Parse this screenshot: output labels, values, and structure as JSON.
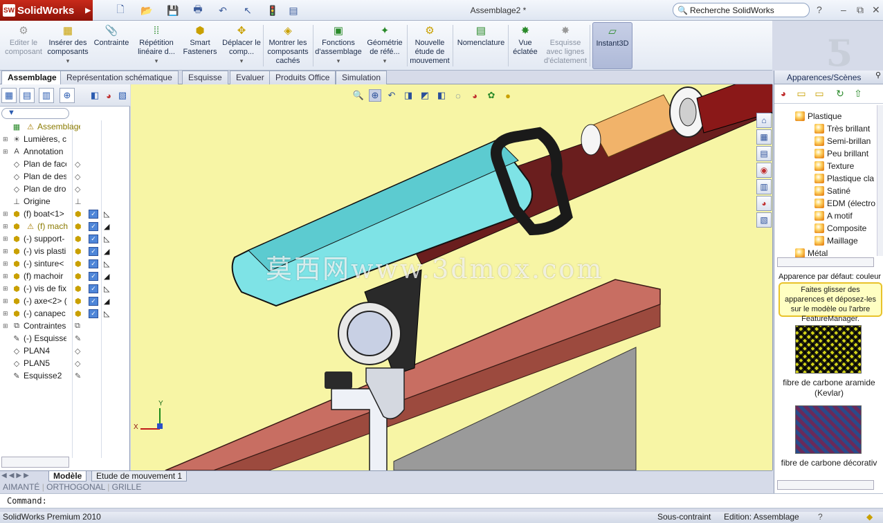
{
  "app": {
    "name": "SolidWorks",
    "doc_title": "Assemblage2 *"
  },
  "search": {
    "placeholder": "Recherche SolidWorks"
  },
  "ribbon": {
    "items": [
      {
        "label": "Editer le composant",
        "disabled": true
      },
      {
        "label": "Insérer des composants",
        "dropdown": true
      },
      {
        "label": "Contrainte"
      },
      {
        "label": "Répétition linéaire d...",
        "dropdown": true
      },
      {
        "label": "Smart Fasteners"
      },
      {
        "label": "Déplacer le comp...",
        "dropdown": true
      },
      {
        "label": "Montrer les composants cachés"
      },
      {
        "label": "Fonctions d'assemblage",
        "dropdown": true
      },
      {
        "label": "Géométrie de réfé...",
        "dropdown": true
      },
      {
        "label": "Nouvelle étude de mouvement"
      },
      {
        "label": "Nomenclature"
      },
      {
        "label": "Vue éclatée"
      },
      {
        "label": "Esquisse avec lignes d'éclatement",
        "disabled": true
      },
      {
        "label": "Instant3D",
        "active": true
      }
    ]
  },
  "command_tabs": [
    "Assemblage",
    "Représentation schématique",
    "Esquisse",
    "Evaluer",
    "Produits Office",
    "Simulation"
  ],
  "feature_tree": {
    "filter_icon": "filter-icon",
    "rows": [
      {
        "label": "Assemblage",
        "warn": true,
        "icon": "assembly-icon"
      },
      {
        "label": "Lumières, c",
        "icon": "lights-icon"
      },
      {
        "label": "Annotation",
        "icon": "annotation-icon"
      },
      {
        "label": "Plan de face",
        "icon": "plane-icon"
      },
      {
        "label": "Plan de des",
        "icon": "plane-icon"
      },
      {
        "label": "Plan de dro",
        "icon": "plane-icon"
      },
      {
        "label": "Origine",
        "icon": "origin-icon"
      },
      {
        "label": "(f) boat<1>",
        "icon": "part-icon"
      },
      {
        "label": "(f) mach",
        "warn": true,
        "icon": "part-icon"
      },
      {
        "label": "(-) support-",
        "icon": "part-icon"
      },
      {
        "label": "(-) vis plasti",
        "icon": "part-icon"
      },
      {
        "label": "(-) sinture<",
        "icon": "part-icon"
      },
      {
        "label": "(f) machoir",
        "icon": "part-icon"
      },
      {
        "label": "(-) vis de fix",
        "icon": "part-icon"
      },
      {
        "label": "(-) axe<2> (",
        "icon": "part-icon"
      },
      {
        "label": "(-) canapec",
        "icon": "part-icon"
      },
      {
        "label": "Contraintes",
        "icon": "mates-icon"
      },
      {
        "label": "(-) Esquisse",
        "icon": "sketch-icon"
      },
      {
        "label": "PLAN4",
        "icon": "plane-icon"
      },
      {
        "label": "PLAN5",
        "icon": "plane-icon"
      },
      {
        "label": "Esquisse2",
        "icon": "sketch-icon"
      }
    ]
  },
  "watermark": "莫西网www.3dmox.com",
  "axis_labels": {
    "x": "X",
    "y": "Y"
  },
  "bottom_tabs": [
    "Modèle",
    "Etude de mouvement 1"
  ],
  "snap_modes": [
    "AIMANTÉ",
    "ORTHOGONAL",
    "GRILLE"
  ],
  "command_line": "Command:",
  "status": {
    "left": "SolidWorks Premium 2010",
    "state": "Sous-contraint",
    "mode": "Edition: Assemblage"
  },
  "appearances": {
    "title": "Apparences/Scènes",
    "category": "Plastique",
    "items": [
      "Très brillant",
      "Semi-brillan",
      "Peu brillant",
      "Texture",
      "Plastique cla",
      "Satiné",
      "EDM (électro",
      "A motif",
      "Composite",
      "Maillage"
    ],
    "next_category": "Métal",
    "default_label": "Apparence par défaut: couleur",
    "tip": "Faites glisser des apparences et déposez-les sur le modèle ou l'arbre FeatureManager.",
    "thumbs": [
      "fibre de carbone aramide (Kevlar)",
      "fibre de carbone décorativ"
    ]
  },
  "colors": {
    "viewport_bg": "#f7f5a5",
    "accent": "#2a4f9a",
    "brand": "#b01c0c",
    "tip_bg": "#ffffc2"
  }
}
